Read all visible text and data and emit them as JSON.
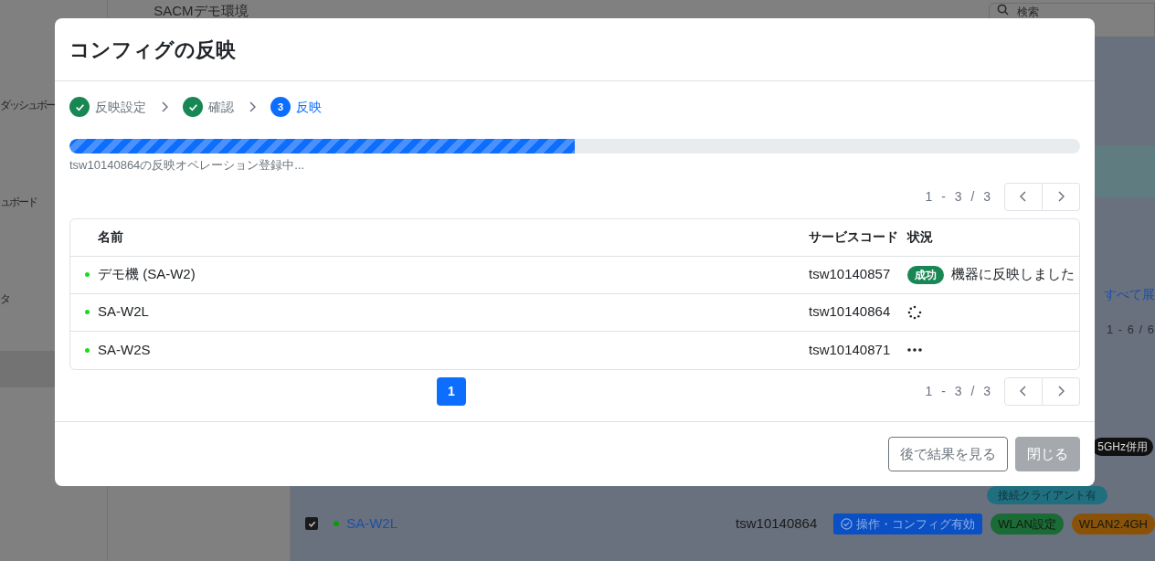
{
  "background": {
    "header_title": "SACMデモ環境",
    "search": {
      "placeholder": "検索"
    },
    "sidebar_items": [
      "ダッシュボー",
      "ュボード",
      "タ"
    ],
    "expand_link": "すべて展",
    "pagination": "1 - 6 / 6",
    "tags_above": [
      "5GHz併用",
      "接続クライアント有"
    ],
    "row": {
      "checked": true,
      "name": "SA-W2L",
      "code": "tsw10140864",
      "badges": [
        {
          "label": "操作・コンフィグ有効",
          "color": "#0b4fc4"
        },
        {
          "label": "WLAN設定",
          "color": "#1a6b35"
        },
        {
          "label": "WLAN2.4GH",
          "color": "#8a5208"
        }
      ]
    }
  },
  "dialog": {
    "title": "コンフィグの反映",
    "steps": [
      {
        "label": "反映設定",
        "completed": true,
        "active": false
      },
      {
        "label": "確認",
        "completed": true,
        "active": false
      },
      {
        "label": "反映",
        "number": "3",
        "completed": false,
        "active": true
      }
    ],
    "progress": {
      "level": 0.5,
      "message": "tsw10140864の反映オペレーション登録中..."
    },
    "pager_top": "1 - 3 / 3",
    "table": {
      "columns": [
        "名前",
        "サービスコード",
        "状況"
      ],
      "rows": [
        {
          "name": "デモ機 (SA-W2)",
          "code": "tsw10140857",
          "status": {
            "kind": "success",
            "badge": "成功",
            "message": "機器に反映しました"
          }
        },
        {
          "name": "SA-W2L",
          "code": "tsw10140864",
          "status": {
            "kind": "loading"
          }
        },
        {
          "name": "SA-W2S",
          "code": "tsw10140871",
          "status": {
            "kind": "pending"
          }
        }
      ]
    },
    "pages": [
      {
        "label": "1",
        "selected": true
      }
    ],
    "pager_bottom": "1 - 3 / 3",
    "buttons": [
      {
        "label": "後で結果を見る",
        "disabled": false
      },
      {
        "label": "閉じる",
        "disabled": true
      }
    ]
  }
}
